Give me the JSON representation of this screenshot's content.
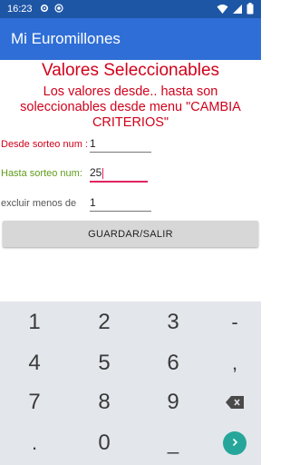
{
  "status_bar": {
    "time": "16:23",
    "left_icons": [
      "settings-icon",
      "record-icon"
    ],
    "right_icons": [
      "wifi-icon",
      "signal-icon",
      "battery-icon"
    ]
  },
  "app_bar": {
    "title": "Mi Euromillones"
  },
  "content": {
    "heading": "Valores Seleccionables",
    "description": "Los valores desde.. hasta son soleccionables desde menu \"CAMBIA CRITERIOS\"",
    "fields": [
      {
        "label": "Desde sorteo num :",
        "value": "1"
      },
      {
        "label": "Hasta sorteo num:",
        "value": "25"
      },
      {
        "label": "excluir menos de",
        "value": "1"
      }
    ],
    "save_button": "GUARDAR/SALIR"
  },
  "keyboard": {
    "row1": [
      "1",
      "2",
      "3",
      "-"
    ],
    "row2": [
      "4",
      "5",
      "6",
      ","
    ],
    "row3": [
      "7",
      "8",
      "9"
    ],
    "row4": [
      ".",
      "0",
      "_"
    ],
    "backspace_icon": "backspace-icon",
    "go_icon": "chevron-right-icon"
  },
  "colors": {
    "status_bar": "#1e56a6",
    "app_bar": "#2f6ed6",
    "accent_red": "#d0021b",
    "accent_green": "#5f9b1a",
    "focus_pink": "#e0245e",
    "go_button": "#26a69a"
  }
}
